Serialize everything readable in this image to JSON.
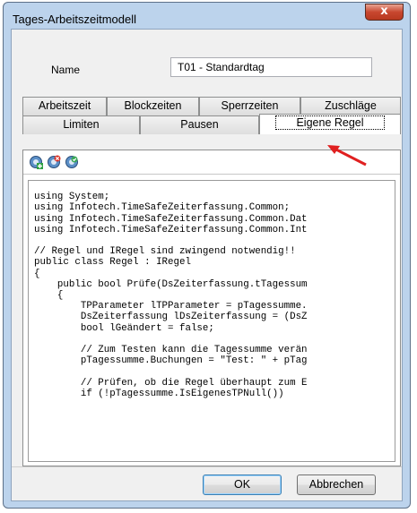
{
  "window": {
    "title": "Tages-Arbeitszeitmodell",
    "close_glyph": "x"
  },
  "name_field": {
    "label": "Name",
    "value": "T01 - Standardtag"
  },
  "tabs_row1": [
    "Arbeitszeit",
    "Blockzeiten",
    "Sperrzeiten",
    "Zuschläge"
  ],
  "tabs_row2": [
    "Limiten",
    "Pausen",
    "Eigene Regel"
  ],
  "active_tab": "Eigene Regel",
  "toolbar": {
    "icons": [
      "add-rule-icon",
      "remove-rule-icon",
      "check-rule-icon"
    ]
  },
  "code_lines": [
    "",
    "using System;",
    "using Infotech.TimeSafeZeiterfassung.Common;",
    "using Infotech.TimeSafeZeiterfassung.Common.Dat",
    "using Infotech.TimeSafeZeiterfassung.Common.Int",
    "",
    "// Regel und IRegel sind zwingend notwendig!!",
    "public class Regel : IRegel",
    "{",
    "    public bool Prüfe(DsZeiterfassung.tTagessum",
    "    {",
    "        TPParameter lTPParameter = pTagessumme.",
    "        DsZeiterfassung lDsZeiterfassung = (DsZ",
    "        bool lGeändert = false;",
    "",
    "        // Zum Testen kann die Tagessumme verän",
    "        pTagessumme.Buchungen = \"Test: \" + pTag",
    "",
    "        // Prüfen, ob die Regel überhaupt zum E",
    "        if (!pTagessumme.IsEigenesTPNull())"
  ],
  "buttons": {
    "ok": "OK",
    "cancel": "Abbrechen"
  },
  "colors": {
    "arrow": "#e02020",
    "frame": "#bcd3ec",
    "close": "#c8472f"
  }
}
